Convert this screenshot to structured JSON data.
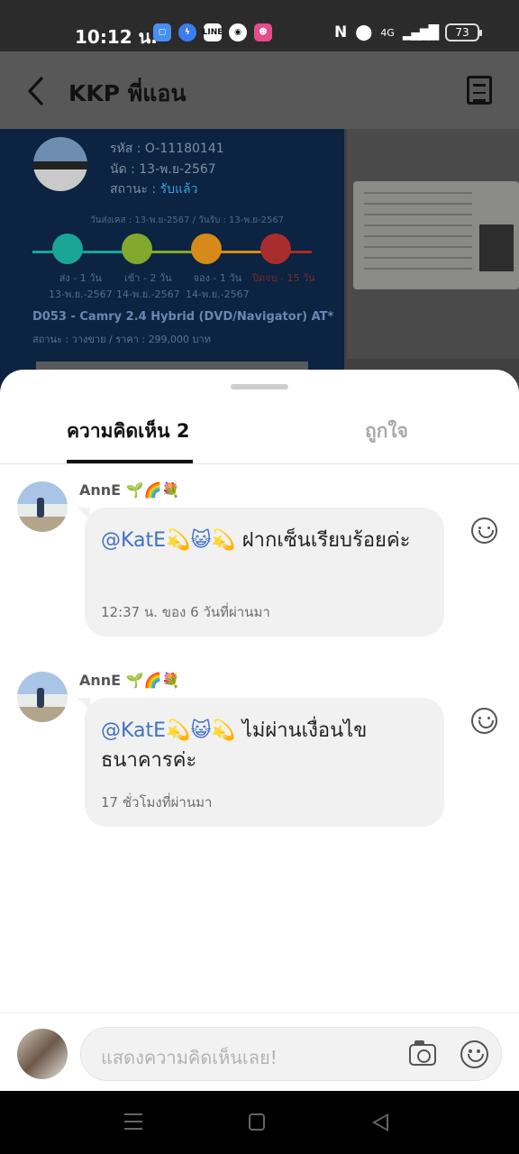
{
  "status_bar": {
    "time": "10:12 น.",
    "apps": [
      {
        "icon": "paper-app-icon",
        "color": "#4a8ff0",
        "label": ""
      },
      {
        "icon": "messenger-icon",
        "color": "#3b7df0",
        "label": ""
      },
      {
        "icon": "line-icon",
        "color": "#2a2a2a",
        "label": "LINE"
      },
      {
        "icon": "tv-app-icon",
        "color": "#2a2a2a",
        "label": ""
      },
      {
        "icon": "cat-app-icon",
        "color": "#e44c8c",
        "label": ""
      }
    ],
    "network": "4G",
    "battery": "73"
  },
  "header": {
    "title": "KKP พี่แอน"
  },
  "background_card": {
    "code_line": "รหัส : O-11180141",
    "date_line": "นัด : 13-พ.ย-2567",
    "status_prefix": "สถานะ : ",
    "status_value": "รับแล้ว",
    "dates_line": "วันส่งเคส : 13-พ.ย-2567 / วันรับ : 13-พ.ย-2567",
    "timeline": [
      {
        "label": "ส่ง - 1 วัน\n13-พ.ย.-2567",
        "color": "#1aa597"
      },
      {
        "label": "เข้า - 2 วัน\n14-พ.ย.-2567",
        "color": "#84a72e"
      },
      {
        "label": "จอง - 1 วัน\n14-พ.ย.-2567",
        "color": "#d68a19"
      },
      {
        "label": "ปิดจบ - 15 วัน",
        "color": "#a82d2d"
      }
    ],
    "car": "D053 - Camry 2.4 Hybrid (DVD/Navigator) AT*",
    "price": "สถานะ : วางขาย / ราคา : 299,000 บาท"
  },
  "sheet": {
    "tabs": [
      {
        "label": "ความคิดเห็น 2",
        "active": true
      },
      {
        "label": "ถูกใจ",
        "active": false
      }
    ],
    "comments": [
      {
        "author": "AnnE 🌱🌈💐",
        "mention": "@KatE💫😺💫",
        "text": " ฝากเซ็นเรียบร้อยค่ะ",
        "time": "12:37 น. ของ 6 วันที่ผ่านมา"
      },
      {
        "author": "AnnE 🌱🌈💐",
        "mention": "@KatE💫😺💫",
        "text": " ไม่ผ่านเงื่อนไขธนาคารค่ะ",
        "time": "17 ชั่วโมงที่ผ่านมา"
      }
    ],
    "input": {
      "placeholder": "แสดงความคิดเห็นเลย!"
    }
  },
  "colors": {
    "mention": "#3f72c7",
    "bubble": "#f1f1f1",
    "overlay": "#585858"
  }
}
